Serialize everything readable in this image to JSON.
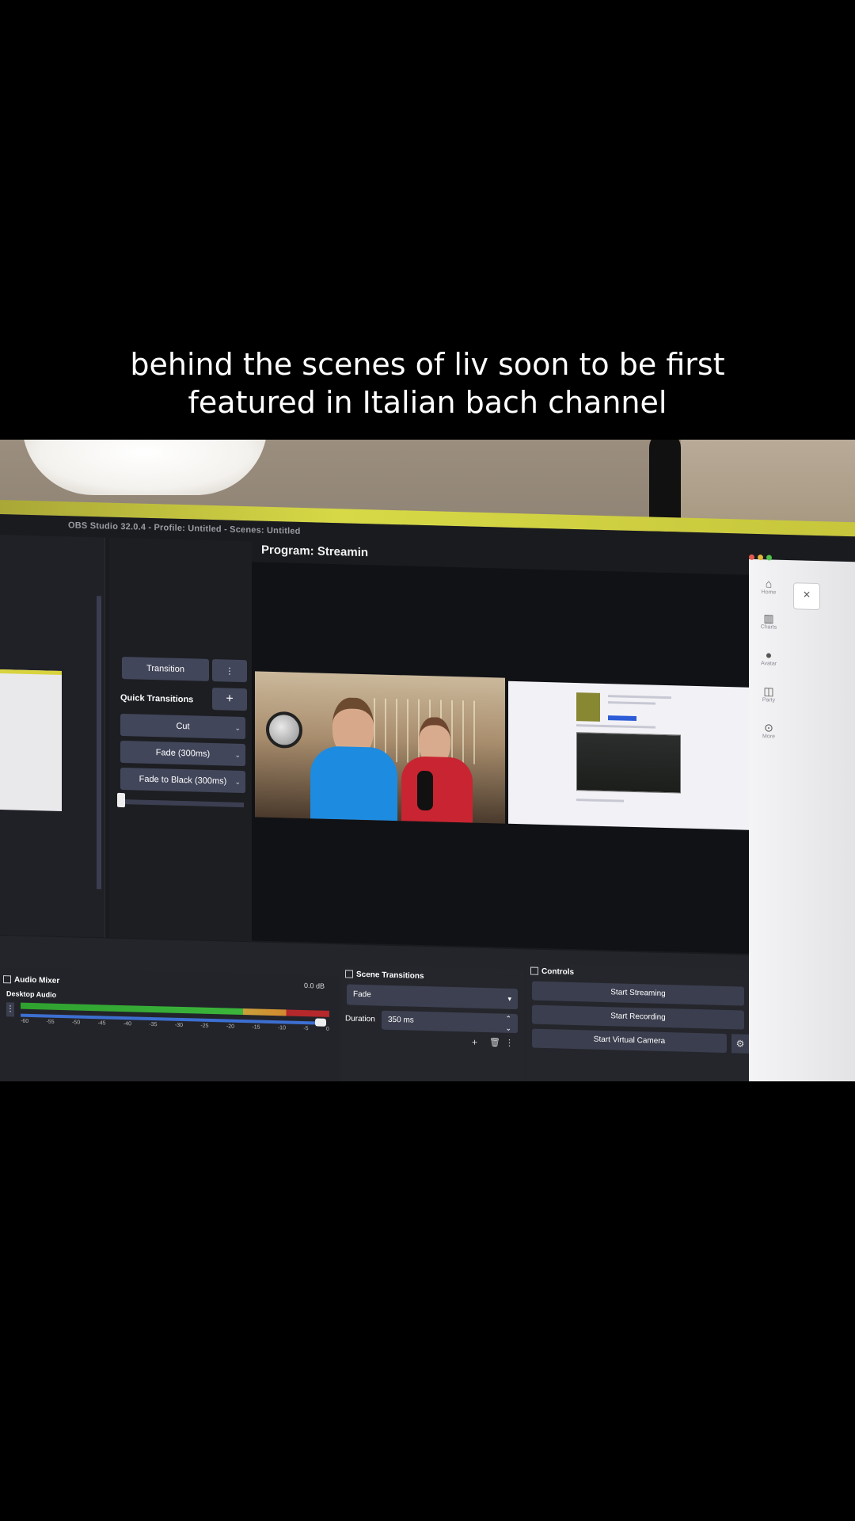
{
  "caption": {
    "line1": "behind the scenes of liv soon to be first",
    "line2": "featured in Italian bach channel"
  },
  "obs": {
    "window_title": "OBS Studio 32.0.4 - Profile: Untitled - Scenes: Untitled",
    "program_label": "Program: Streamin"
  },
  "transitions": {
    "transition_button": "Transition",
    "more_icon": "⋮",
    "quick_transitions_label": "Quick Transitions",
    "add_icon": "+",
    "items": [
      {
        "label": "Cut"
      },
      {
        "label": "Fade (300ms)"
      },
      {
        "label": "Fade to Black (300ms)"
      }
    ],
    "chevron": "⌄"
  },
  "sidebar": {
    "home": "Home",
    "charts": "Charts",
    "avatar": "Avatar",
    "party": "Party",
    "more": "More",
    "close": "×"
  },
  "audio_mixer": {
    "title": "Audio Mixer",
    "db_value": "0.0 dB",
    "source": "Desktop Audio",
    "ticks": [
      "-60",
      "-55",
      "-50",
      "-45",
      "-40",
      "-35",
      "-30",
      "-25",
      "-20",
      "-15",
      "-10",
      "-5",
      "0"
    ]
  },
  "scene_transitions": {
    "title": "Scene Transitions",
    "selected": "Fade",
    "duration_label": "Duration",
    "duration_value": "350 ms"
  },
  "controls": {
    "title": "Controls",
    "start_streaming": "Start Streaming",
    "start_recording": "Start Recording",
    "start_virtual_camera": "Start Virtual Camera"
  },
  "colors": {
    "obs_background": "#1a1b1f",
    "button": "#42465a",
    "bezel_accent": "#d7d946"
  }
}
